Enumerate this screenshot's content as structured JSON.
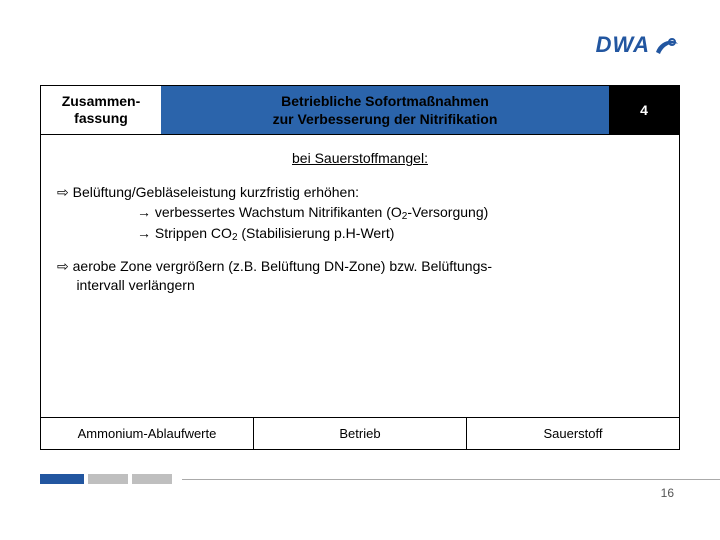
{
  "logo": {
    "text": "DWA"
  },
  "header": {
    "left_line1": "Zusammen-",
    "left_line2": "fassung",
    "mid_line1": "Betriebliche Sofortmaßnahmen",
    "mid_line2": "zur Verbesserung der Nitrifikation",
    "right": "4"
  },
  "subtitle": "bei Sauerstoffmangel:",
  "bullets": [
    {
      "line1": "⇨ Belüftung/Gebläseleistung kurzfristig erhöhen:",
      "sub1_pre": "→ verbessertes Wachstum Nitrifikanten (O",
      "sub1_post": "-Versorgung)",
      "sub2_pre": "→ Strippen CO",
      "sub2_post": "  (Stabilisierung p.H-Wert)"
    },
    {
      "line1": "⇨  aerobe Zone vergrößern (z.B. Belüftung DN-Zone) bzw. Belüftungs-",
      "line2": "     intervall verlängern"
    }
  ],
  "subscript_2": "2",
  "footer": {
    "c1": "Ammonium-Ablaufwerte",
    "c2": "Betrieb",
    "c3": "Sauerstoff"
  },
  "page_number": "16"
}
